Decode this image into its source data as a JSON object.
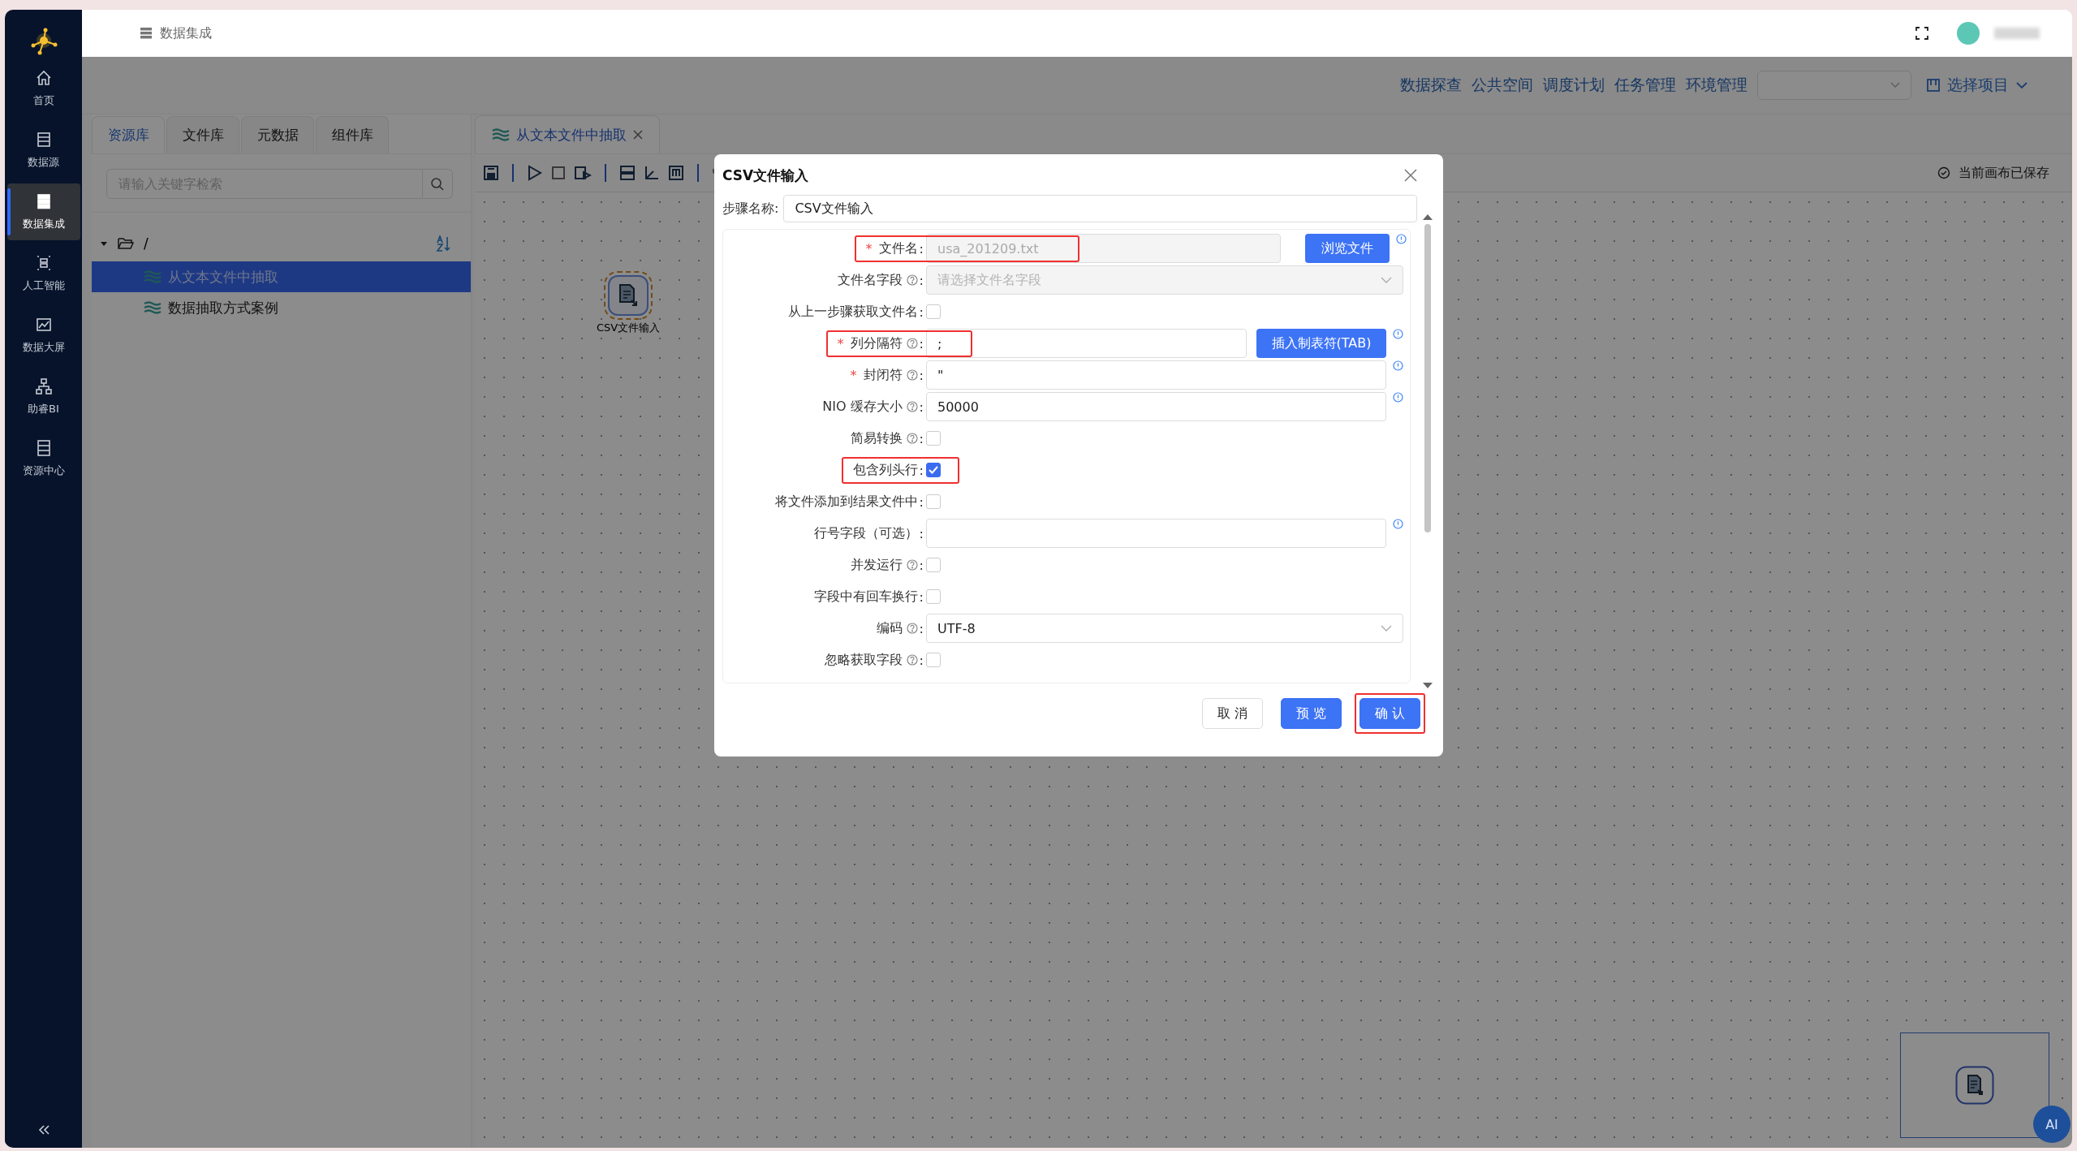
{
  "sidebar": {
    "items": [
      {
        "label": "首页",
        "selected": false
      },
      {
        "label": "数据源",
        "selected": false
      },
      {
        "label": "数据集成",
        "selected": true
      },
      {
        "label": "人工智能",
        "selected": false
      },
      {
        "label": "数据大屏",
        "selected": false
      },
      {
        "label": "助睿BI",
        "selected": false
      },
      {
        "label": "资源中心",
        "selected": false
      }
    ]
  },
  "header": {
    "breadcrumb": "数据集成"
  },
  "top_nav": {
    "links": [
      "数据探查",
      "公共空间",
      "调度计划",
      "任务管理",
      "环境管理"
    ],
    "project_button": "选择项目"
  },
  "resource_panel": {
    "tabs": [
      {
        "label": "资源库",
        "selected": true
      },
      {
        "label": "文件库",
        "selected": false
      },
      {
        "label": "元数据",
        "selected": false
      },
      {
        "label": "组件库",
        "selected": false
      }
    ],
    "search": {
      "placeholder": "请输入关键字检索"
    },
    "tree": {
      "label": "/",
      "expanded": true,
      "children": [
        {
          "label": "从文本文件中抽取",
          "selected": true
        },
        {
          "label": "数据抽取方式案例",
          "selected": false
        }
      ]
    }
  },
  "editor": {
    "tabs": [
      {
        "label": "从文本文件中抽取",
        "selected": true
      }
    ],
    "save_status": "当前画布已保存",
    "nodes": [
      {
        "label": "CSV文件输入",
        "selected": true
      }
    ]
  },
  "dialog": {
    "title": "CSV文件输入",
    "step_name": {
      "label": "步骤名称:",
      "value": "CSV文件输入"
    },
    "fields": [
      {
        "label": "文件名",
        "required_mark": "*",
        "suffix": ":",
        "kind": "file",
        "help": false,
        "info": true,
        "highlighted": true,
        "disabled": true,
        "value": "usa_201209.txt",
        "button": "浏览文件"
      },
      {
        "label": "文件名字段",
        "suffix": ":",
        "kind": "select",
        "help": true,
        "info": false,
        "highlighted": false,
        "disabled": true,
        "placeholder": "请选择文件名字段"
      },
      {
        "label": "从上一步骤获取文件名",
        "suffix": ":",
        "kind": "checkbox",
        "help": false,
        "info": false,
        "highlighted": false,
        "checked": false
      },
      {
        "label": "列分隔符",
        "required_mark": "*",
        "suffix": ":",
        "kind": "text",
        "help": true,
        "info": true,
        "highlighted": true,
        "disabled": false,
        "value": ";",
        "button": "插入制表符(TAB)"
      },
      {
        "label": "封闭符",
        "required_mark": "*",
        "suffix": ":",
        "kind": "text",
        "help": true,
        "info": true,
        "highlighted": false,
        "disabled": false,
        "value": "\""
      },
      {
        "label": "NIO 缓存大小",
        "suffix": ":",
        "kind": "text",
        "help": true,
        "info": true,
        "highlighted": false,
        "disabled": false,
        "value": "50000"
      },
      {
        "label": "简易转换",
        "suffix": ":",
        "kind": "checkbox",
        "help": true,
        "info": false,
        "highlighted": false,
        "checked": false
      },
      {
        "label": "包含列头行",
        "suffix": ":",
        "kind": "checkbox",
        "help": false,
        "info": false,
        "highlighted": true,
        "checked": true
      },
      {
        "label": "将文件添加到结果文件中",
        "suffix": ":",
        "kind": "checkbox",
        "help": false,
        "info": false,
        "highlighted": false,
        "checked": false
      },
      {
        "label": "行号字段（可选）",
        "suffix": ":",
        "kind": "text",
        "help": false,
        "info": true,
        "highlighted": false,
        "disabled": false
      },
      {
        "label": "并发运行",
        "suffix": ":",
        "kind": "checkbox",
        "help": true,
        "info": false,
        "highlighted": false,
        "checked": false
      },
      {
        "label": "字段中有回车换行",
        "suffix": ":",
        "kind": "checkbox",
        "help": false,
        "info": false,
        "highlighted": false,
        "checked": false
      },
      {
        "label": "编码",
        "suffix": ":",
        "kind": "select",
        "help": true,
        "info": false,
        "highlighted": false,
        "disabled": false,
        "value": "UTF-8"
      },
      {
        "label": "忽略获取字段",
        "suffix": ":",
        "kind": "checkbox",
        "help": true,
        "info": false,
        "highlighted": false,
        "checked": false
      }
    ],
    "buttons": [
      {
        "label": "取 消",
        "kind": "default",
        "highlighted": false
      },
      {
        "label": "预 览",
        "kind": "primary",
        "highlighted": false
      },
      {
        "label": "确 认",
        "kind": "primary",
        "highlighted": true
      }
    ]
  },
  "ai_button": "AI"
}
